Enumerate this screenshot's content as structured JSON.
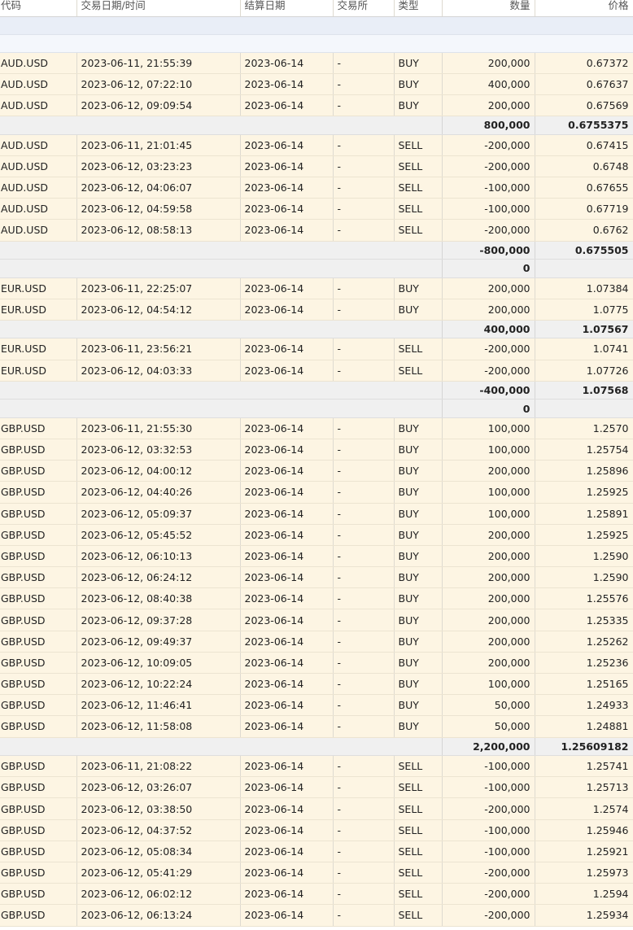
{
  "columns": {
    "symbol": "代码",
    "datetime": "交易日期/时间",
    "settle": "结算日期",
    "exchange": "交易所",
    "type": "类型",
    "quantity": "数量",
    "price": "价格"
  },
  "groups": [
    {
      "rows": [
        {
          "symbol": "AUD.USD",
          "datetime": "2023-06-11, 21:55:39",
          "settle": "2023-06-14",
          "exchange": "-",
          "type": "BUY",
          "quantity": "200,000",
          "price": "0.67372"
        },
        {
          "symbol": "AUD.USD",
          "datetime": "2023-06-12, 07:22:10",
          "settle": "2023-06-14",
          "exchange": "-",
          "type": "BUY",
          "quantity": "400,000",
          "price": "0.67637"
        },
        {
          "symbol": "AUD.USD",
          "datetime": "2023-06-12, 09:09:54",
          "settle": "2023-06-14",
          "exchange": "-",
          "type": "BUY",
          "quantity": "200,000",
          "price": "0.67569"
        }
      ],
      "subtotal": {
        "quantity": "800,000",
        "price": "0.6755375"
      }
    },
    {
      "rows": [
        {
          "symbol": "AUD.USD",
          "datetime": "2023-06-11, 21:01:45",
          "settle": "2023-06-14",
          "exchange": "-",
          "type": "SELL",
          "quantity": "-200,000",
          "price": "0.67415"
        },
        {
          "symbol": "AUD.USD",
          "datetime": "2023-06-12, 03:23:23",
          "settle": "2023-06-14",
          "exchange": "-",
          "type": "SELL",
          "quantity": "-200,000",
          "price": "0.6748"
        },
        {
          "symbol": "AUD.USD",
          "datetime": "2023-06-12, 04:06:07",
          "settle": "2023-06-14",
          "exchange": "-",
          "type": "SELL",
          "quantity": "-100,000",
          "price": "0.67655"
        },
        {
          "symbol": "AUD.USD",
          "datetime": "2023-06-12, 04:59:58",
          "settle": "2023-06-14",
          "exchange": "-",
          "type": "SELL",
          "quantity": "-100,000",
          "price": "0.67719"
        },
        {
          "symbol": "AUD.USD",
          "datetime": "2023-06-12, 08:58:13",
          "settle": "2023-06-14",
          "exchange": "-",
          "type": "SELL",
          "quantity": "-200,000",
          "price": "0.6762"
        }
      ],
      "subtotal": {
        "quantity": "-800,000",
        "price": "0.675505"
      },
      "net": "0"
    },
    {
      "rows": [
        {
          "symbol": "EUR.USD",
          "datetime": "2023-06-11, 22:25:07",
          "settle": "2023-06-14",
          "exchange": "-",
          "type": "BUY",
          "quantity": "200,000",
          "price": "1.07384"
        },
        {
          "symbol": "EUR.USD",
          "datetime": "2023-06-12, 04:54:12",
          "settle": "2023-06-14",
          "exchange": "-",
          "type": "BUY",
          "quantity": "200,000",
          "price": "1.0775"
        }
      ],
      "subtotal": {
        "quantity": "400,000",
        "price": "1.07567"
      }
    },
    {
      "rows": [
        {
          "symbol": "EUR.USD",
          "datetime": "2023-06-11, 23:56:21",
          "settle": "2023-06-14",
          "exchange": "-",
          "type": "SELL",
          "quantity": "-200,000",
          "price": "1.0741"
        },
        {
          "symbol": "EUR.USD",
          "datetime": "2023-06-12, 04:03:33",
          "settle": "2023-06-14",
          "exchange": "-",
          "type": "SELL",
          "quantity": "-200,000",
          "price": "1.07726"
        }
      ],
      "subtotal": {
        "quantity": "-400,000",
        "price": "1.07568"
      },
      "net": "0"
    },
    {
      "rows": [
        {
          "symbol": "GBP.USD",
          "datetime": "2023-06-11, 21:55:30",
          "settle": "2023-06-14",
          "exchange": "-",
          "type": "BUY",
          "quantity": "100,000",
          "price": "1.2570"
        },
        {
          "symbol": "GBP.USD",
          "datetime": "2023-06-12, 03:32:53",
          "settle": "2023-06-14",
          "exchange": "-",
          "type": "BUY",
          "quantity": "100,000",
          "price": "1.25754"
        },
        {
          "symbol": "GBP.USD",
          "datetime": "2023-06-12, 04:00:12",
          "settle": "2023-06-14",
          "exchange": "-",
          "type": "BUY",
          "quantity": "200,000",
          "price": "1.25896"
        },
        {
          "symbol": "GBP.USD",
          "datetime": "2023-06-12, 04:40:26",
          "settle": "2023-06-14",
          "exchange": "-",
          "type": "BUY",
          "quantity": "100,000",
          "price": "1.25925"
        },
        {
          "symbol": "GBP.USD",
          "datetime": "2023-06-12, 05:09:37",
          "settle": "2023-06-14",
          "exchange": "-",
          "type": "BUY",
          "quantity": "100,000",
          "price": "1.25891"
        },
        {
          "symbol": "GBP.USD",
          "datetime": "2023-06-12, 05:45:52",
          "settle": "2023-06-14",
          "exchange": "-",
          "type": "BUY",
          "quantity": "200,000",
          "price": "1.25925"
        },
        {
          "symbol": "GBP.USD",
          "datetime": "2023-06-12, 06:10:13",
          "settle": "2023-06-14",
          "exchange": "-",
          "type": "BUY",
          "quantity": "200,000",
          "price": "1.2590"
        },
        {
          "symbol": "GBP.USD",
          "datetime": "2023-06-12, 06:24:12",
          "settle": "2023-06-14",
          "exchange": "-",
          "type": "BUY",
          "quantity": "200,000",
          "price": "1.2590"
        },
        {
          "symbol": "GBP.USD",
          "datetime": "2023-06-12, 08:40:38",
          "settle": "2023-06-14",
          "exchange": "-",
          "type": "BUY",
          "quantity": "200,000",
          "price": "1.25576"
        },
        {
          "symbol": "GBP.USD",
          "datetime": "2023-06-12, 09:37:28",
          "settle": "2023-06-14",
          "exchange": "-",
          "type": "BUY",
          "quantity": "200,000",
          "price": "1.25335"
        },
        {
          "symbol": "GBP.USD",
          "datetime": "2023-06-12, 09:49:37",
          "settle": "2023-06-14",
          "exchange": "-",
          "type": "BUY",
          "quantity": "200,000",
          "price": "1.25262"
        },
        {
          "symbol": "GBP.USD",
          "datetime": "2023-06-12, 10:09:05",
          "settle": "2023-06-14",
          "exchange": "-",
          "type": "BUY",
          "quantity": "200,000",
          "price": "1.25236"
        },
        {
          "symbol": "GBP.USD",
          "datetime": "2023-06-12, 10:22:24",
          "settle": "2023-06-14",
          "exchange": "-",
          "type": "BUY",
          "quantity": "100,000",
          "price": "1.25165"
        },
        {
          "symbol": "GBP.USD",
          "datetime": "2023-06-12, 11:46:41",
          "settle": "2023-06-14",
          "exchange": "-",
          "type": "BUY",
          "quantity": "50,000",
          "price": "1.24933"
        },
        {
          "symbol": "GBP.USD",
          "datetime": "2023-06-12, 11:58:08",
          "settle": "2023-06-14",
          "exchange": "-",
          "type": "BUY",
          "quantity": "50,000",
          "price": "1.24881"
        }
      ],
      "subtotal": {
        "quantity": "2,200,000",
        "price": "1.25609182"
      }
    },
    {
      "rows": [
        {
          "symbol": "GBP.USD",
          "datetime": "2023-06-11, 21:08:22",
          "settle": "2023-06-14",
          "exchange": "-",
          "type": "SELL",
          "quantity": "-100,000",
          "price": "1.25741"
        },
        {
          "symbol": "GBP.USD",
          "datetime": "2023-06-12, 03:26:07",
          "settle": "2023-06-14",
          "exchange": "-",
          "type": "SELL",
          "quantity": "-100,000",
          "price": "1.25713"
        },
        {
          "symbol": "GBP.USD",
          "datetime": "2023-06-12, 03:38:50",
          "settle": "2023-06-14",
          "exchange": "-",
          "type": "SELL",
          "quantity": "-200,000",
          "price": "1.2574"
        },
        {
          "symbol": "GBP.USD",
          "datetime": "2023-06-12, 04:37:52",
          "settle": "2023-06-14",
          "exchange": "-",
          "type": "SELL",
          "quantity": "-100,000",
          "price": "1.25946"
        },
        {
          "symbol": "GBP.USD",
          "datetime": "2023-06-12, 05:08:34",
          "settle": "2023-06-14",
          "exchange": "-",
          "type": "SELL",
          "quantity": "-100,000",
          "price": "1.25921"
        },
        {
          "symbol": "GBP.USD",
          "datetime": "2023-06-12, 05:41:29",
          "settle": "2023-06-14",
          "exchange": "-",
          "type": "SELL",
          "quantity": "-200,000",
          "price": "1.25973"
        },
        {
          "symbol": "GBP.USD",
          "datetime": "2023-06-12, 06:02:12",
          "settle": "2023-06-14",
          "exchange": "-",
          "type": "SELL",
          "quantity": "-200,000",
          "price": "1.2594"
        },
        {
          "symbol": "GBP.USD",
          "datetime": "2023-06-12, 06:13:24",
          "settle": "2023-06-14",
          "exchange": "-",
          "type": "SELL",
          "quantity": "-200,000",
          "price": "1.25934"
        }
      ]
    }
  ]
}
